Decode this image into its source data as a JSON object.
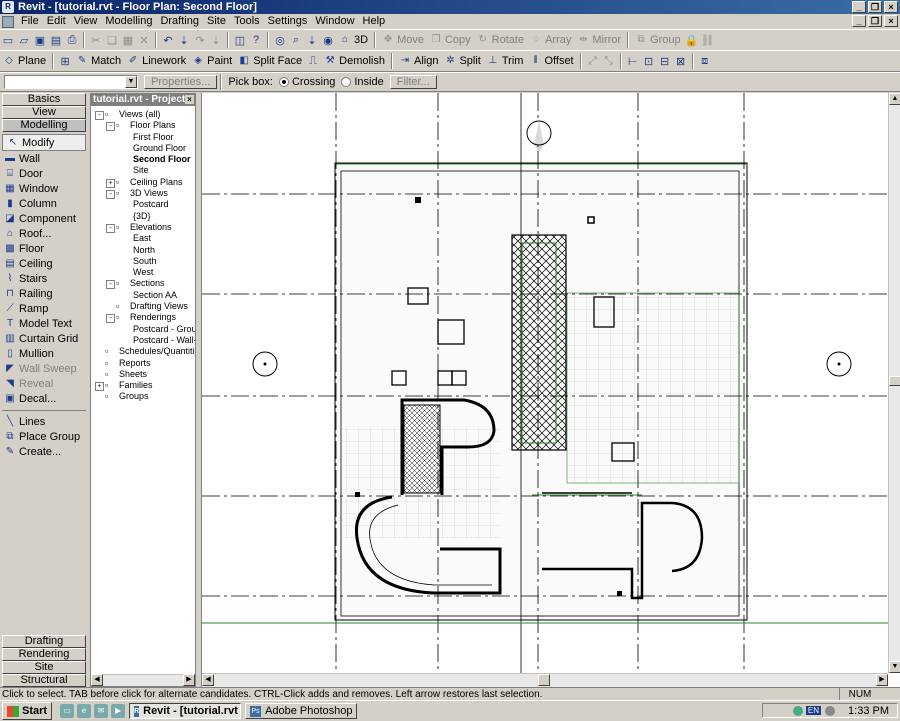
{
  "window": {
    "title": "Revit - [tutorial.rvt - Floor Plan: Second Floor]"
  },
  "menu": [
    "File",
    "Edit",
    "View",
    "Modelling",
    "Drafting",
    "Site",
    "Tools",
    "Settings",
    "Window",
    "Help"
  ],
  "toolbar1": {
    "view3d": "3D",
    "move": "Move",
    "copy": "Copy",
    "rotate": "Rotate",
    "array": "Array",
    "mirror": "Mirror",
    "group": "Group"
  },
  "toolbar2": {
    "plane": "Plane",
    "match": "Match",
    "linework": "Linework",
    "paint": "Paint",
    "split_face": "Split Face",
    "demolish": "Demolish",
    "align": "Align",
    "split": "Split",
    "trim": "Trim",
    "offset": "Offset"
  },
  "options_bar": {
    "type_value": "",
    "properties": "Properties...",
    "pick_box_label": "Pick box:",
    "crossing": "Crossing",
    "inside": "Inside",
    "filter": "Filter..."
  },
  "design_bar": {
    "tabs_top": [
      "Basics",
      "View",
      "Modelling"
    ],
    "tools": [
      {
        "label": "Modify",
        "icon": "cursor-icon",
        "selected": true
      },
      {
        "label": "Wall",
        "icon": "wall-icon"
      },
      {
        "label": "Door",
        "icon": "door-icon"
      },
      {
        "label": "Window",
        "icon": "window-icon"
      },
      {
        "label": "Column",
        "icon": "column-icon"
      },
      {
        "label": "Component",
        "icon": "component-icon"
      },
      {
        "label": "Roof...",
        "icon": "roof-icon"
      },
      {
        "label": "Floor",
        "icon": "floor-icon"
      },
      {
        "label": "Ceiling",
        "icon": "ceiling-icon"
      },
      {
        "label": "Stairs",
        "icon": "stairs-icon"
      },
      {
        "label": "Railing",
        "icon": "railing-icon"
      },
      {
        "label": "Ramp",
        "icon": "ramp-icon"
      },
      {
        "label": "Model Text",
        "icon": "text-icon"
      },
      {
        "label": "Curtain Grid",
        "icon": "curtain-grid-icon"
      },
      {
        "label": "Mullion",
        "icon": "mullion-icon"
      },
      {
        "label": "Wall Sweep",
        "icon": "wall-sweep-icon",
        "disabled": true
      },
      {
        "label": "Reveal",
        "icon": "reveal-icon",
        "disabled": true
      },
      {
        "label": "Decal...",
        "icon": "decal-icon"
      }
    ],
    "tools2": [
      {
        "label": "Lines",
        "icon": "lines-icon"
      },
      {
        "label": "Place Group",
        "icon": "place-group-icon"
      },
      {
        "label": "Create...",
        "icon": "create-icon"
      }
    ],
    "tabs_bottom": [
      "Drafting",
      "Rendering",
      "Site",
      "Structural"
    ]
  },
  "browser": {
    "header": "tutorial.rvt - Project ...",
    "items": [
      {
        "label": "Views (all)",
        "level": 0,
        "exp": "-"
      },
      {
        "label": "Floor Plans",
        "level": 1,
        "exp": "-"
      },
      {
        "label": "First Floor",
        "level": 2
      },
      {
        "label": "Ground Floor",
        "level": 2
      },
      {
        "label": "Second Floor",
        "level": 2,
        "bold": true
      },
      {
        "label": "Site",
        "level": 2
      },
      {
        "label": "Ceiling Plans",
        "level": 1,
        "exp": "+"
      },
      {
        "label": "3D Views",
        "level": 1,
        "exp": "-"
      },
      {
        "label": "Postcard",
        "level": 2
      },
      {
        "label": "{3D}",
        "level": 2
      },
      {
        "label": "Elevations",
        "level": 1,
        "exp": "-"
      },
      {
        "label": "East",
        "level": 2
      },
      {
        "label": "North",
        "level": 2
      },
      {
        "label": "South",
        "level": 2
      },
      {
        "label": "West",
        "level": 2
      },
      {
        "label": "Sections",
        "level": 1,
        "exp": "-"
      },
      {
        "label": "Section AA",
        "level": 2
      },
      {
        "label": "Drafting Views",
        "level": 1
      },
      {
        "label": "Renderings",
        "level": 1,
        "exp": "-"
      },
      {
        "label": "Postcard - Grou",
        "level": 2
      },
      {
        "label": "Postcard - Wall-",
        "level": 2
      },
      {
        "label": "Schedules/Quantities",
        "level": 0
      },
      {
        "label": "Reports",
        "level": 0
      },
      {
        "label": "Sheets",
        "level": 0
      },
      {
        "label": "Families",
        "level": 0,
        "exp": "+"
      },
      {
        "label": "Groups",
        "level": 0
      }
    ]
  },
  "status": {
    "message": "Click to select. TAB before click for alternate candidates. CTRL-Click adds and removes. Left arrow restores last selection.",
    "num": "NUM"
  },
  "taskbar": {
    "start": "Start",
    "items": [
      {
        "label": "Revit - [tutorial.rvt ...",
        "active": true
      },
      {
        "label": "Adobe Photoshop",
        "active": false
      }
    ],
    "lang": "EN",
    "clock": "1:33 PM"
  }
}
